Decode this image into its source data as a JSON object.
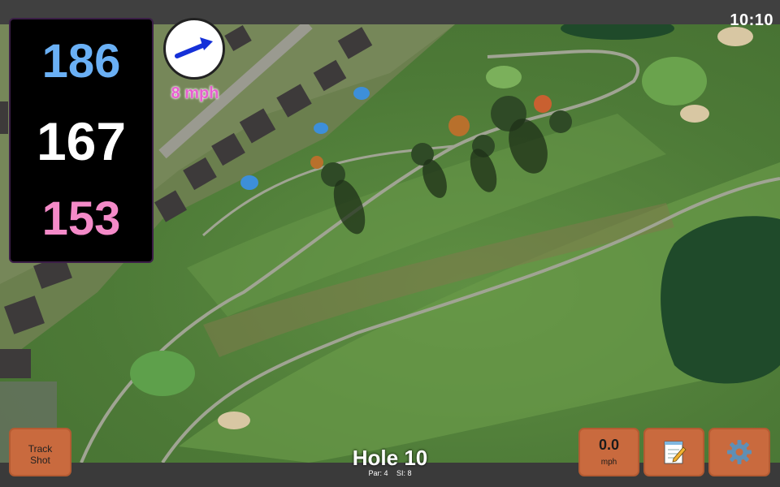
{
  "status": {
    "time": "10:10"
  },
  "distances": {
    "back": "186",
    "center": "167",
    "front": "153"
  },
  "wind": {
    "speed_label": "8 mph",
    "arrow_icon": "wind-arrow-icon"
  },
  "track_button": {
    "line1": "Track",
    "line2": "Shot"
  },
  "speed_button": {
    "value": "0.0",
    "unit": "mph"
  },
  "notes_button": {
    "icon": "notepad-icon"
  },
  "settings_button": {
    "icon": "gear-icon"
  },
  "hole": {
    "title": "Hole 10",
    "par": "Par: 4",
    "si": "SI: 8"
  },
  "colors": {
    "back": "#6ab0f5",
    "center": "#ffffff",
    "front": "#f48ac8",
    "button": "#c96a3e",
    "wind_text": "#e85fd0"
  }
}
